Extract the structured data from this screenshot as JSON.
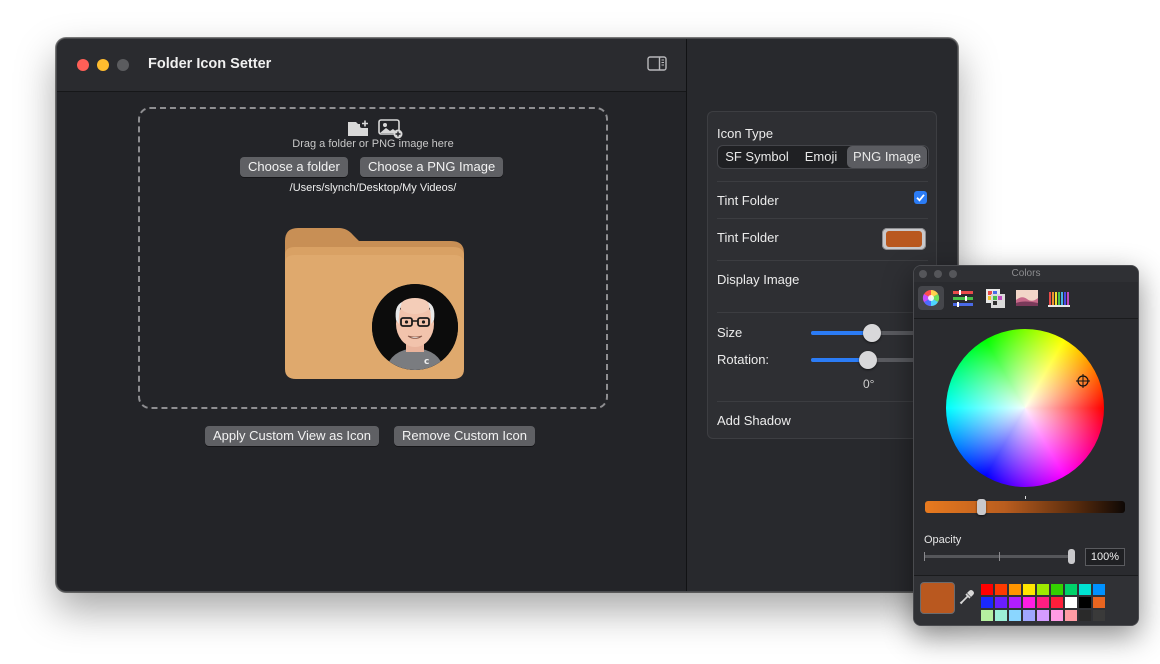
{
  "window": {
    "title": "Folder Icon Setter"
  },
  "drop_zone": {
    "hint": "Drag a folder or PNG image here",
    "choose_folder_label": "Choose a folder",
    "choose_png_label": "Choose a PNG Image",
    "path": "/Users/slynch/Desktop/My Videos/"
  },
  "actions": {
    "apply_label": "Apply Custom View as Icon",
    "remove_label": "Remove Custom Icon"
  },
  "inspector": {
    "icon_type_label": "Icon Type",
    "icon_types": [
      "SF Symbol",
      "Emoji",
      "PNG Image"
    ],
    "selected_icon_type": "PNG Image",
    "tint_checkbox_label": "Tint Folder",
    "tint_checked": true,
    "tint_color_label": "Tint Folder",
    "tint_color": "#b9581f",
    "display_image_label": "Display Image",
    "size_label": "Size",
    "size_value": 0.55,
    "rotation_label": "Rotation:",
    "rotation_value": "0°",
    "add_shadow_label": "Add Shadow"
  },
  "colors_panel": {
    "title": "Colors",
    "modes": [
      "color-wheel",
      "color-sliders",
      "color-palettes",
      "image-palettes",
      "pencils"
    ],
    "selected_mode": "color-wheel",
    "opacity_label": "Opacity",
    "opacity_value": "100%",
    "current_color": "#b9581f",
    "swatches": [
      [
        "#ff0000",
        "#ff3a00",
        "#ff9500",
        "#ffe600",
        "#9eea00",
        "#34d100",
        "#00d26a",
        "#00e2d2",
        "#0091ff"
      ],
      [
        "#1a28ff",
        "#6a1eff",
        "#b01eff",
        "#ff1ee2",
        "#ff1e82",
        "#ff1e3a",
        "#ffffff",
        "#000000",
        "#e86520"
      ],
      [
        "#b6f0a0",
        "#9cf0d8",
        "#8ad6ff",
        "#a0a6ff",
        "#d49cff",
        "#ff9ce4",
        "#ff9ca4",
        "#2a2a2a",
        "#3a3a3a"
      ]
    ]
  }
}
